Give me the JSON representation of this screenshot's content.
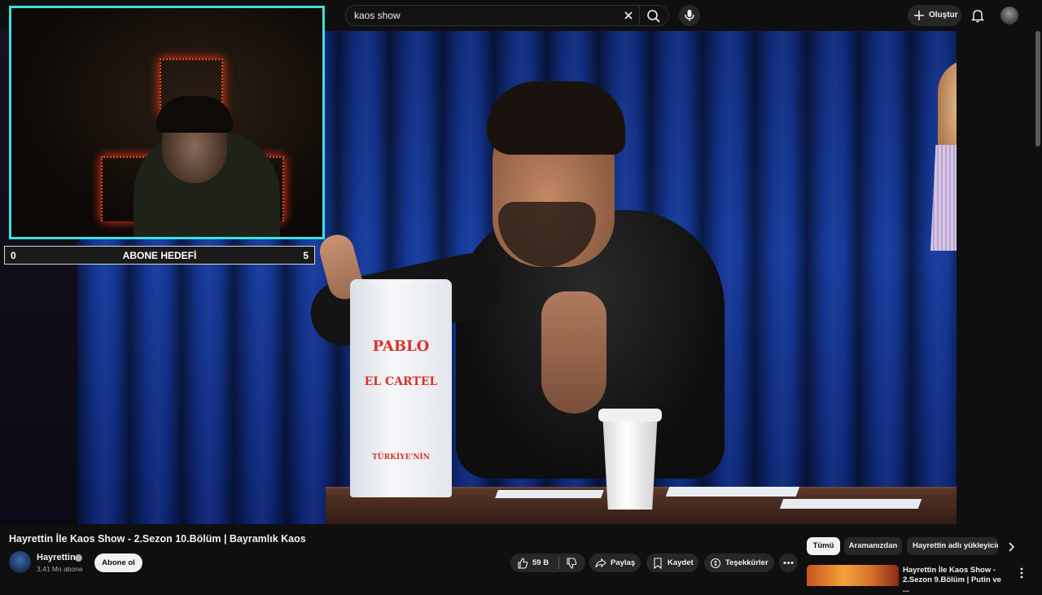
{
  "header": {
    "search_query": "kaos show",
    "create_label": "Oluştur"
  },
  "overlay": {
    "goal_start": "0",
    "goal_title": "ABONE HEDEFİ",
    "goal_end": "5"
  },
  "video_props": {
    "bag_brand": "PABLO",
    "bag_sub": "EL CARTEL",
    "bag_bottom": "TÜRKİYE'NİN"
  },
  "video": {
    "title": "Hayrettin İle Kaos Show - 2.Sezon 10.Bölüm | Bayramlık Kaos",
    "channel": "Hayrettin",
    "subscribers": "3,41 Mn abone",
    "subscribe_label": "Abone ol",
    "likes": "59 B",
    "share_label": "Paylaş",
    "save_label": "Kaydet",
    "thanks_label": "Teşekkürler"
  },
  "chips": [
    {
      "label": "Tümü"
    },
    {
      "label": "Aramanızdan"
    },
    {
      "label": "Hayrettin adlı yükleyicid"
    }
  ],
  "related": [
    {
      "title_line1": "Hayrettin İle Kaos Show -",
      "title_line2": "2.Sezon 9.Bölüm | Putin ve ..."
    }
  ],
  "colors": {
    "background": "#0f0f0f",
    "webcam_border": "#3fe0e0",
    "curtain": "#163a9a"
  }
}
